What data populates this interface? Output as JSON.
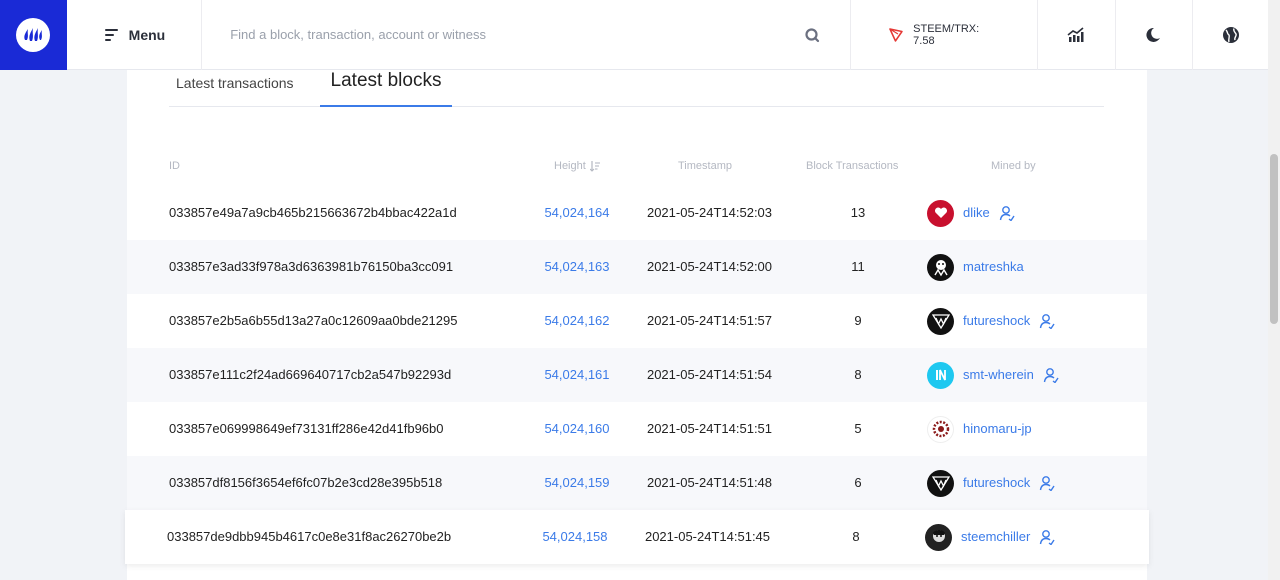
{
  "header": {
    "menu_label": "Menu",
    "search_placeholder": "Find a block, transaction, account or witness",
    "price_label": "STEEM/TRX: 7.58",
    "colors": {
      "brand": "#1a2ad6",
      "accent": "#3b7be8"
    }
  },
  "tabs": [
    {
      "label": "Latest transactions",
      "active": false
    },
    {
      "label": "Latest blocks",
      "active": true
    }
  ],
  "table": {
    "headers": {
      "id": "ID",
      "height": "Height",
      "timestamp": "Timestamp",
      "block_tx": "Block Transactions",
      "mined_by": "Mined by"
    },
    "rows": [
      {
        "id": "033857e49a7a9cb465b215663672b4bbac422a1d",
        "height": "54,024,164",
        "timestamp": "2021-05-24T14:52:03",
        "tx": "13",
        "miner": "dlike",
        "witness_icon": true
      },
      {
        "id": "033857e3ad33f978a3d6363981b76150ba3cc091",
        "height": "54,024,163",
        "timestamp": "2021-05-24T14:52:00",
        "tx": "11",
        "miner": "matreshka",
        "witness_icon": false
      },
      {
        "id": "033857e2b5a6b55d13a27a0c12609aa0bde21295",
        "height": "54,024,162",
        "timestamp": "2021-05-24T14:51:57",
        "tx": "9",
        "miner": "futureshock",
        "witness_icon": true
      },
      {
        "id": "033857e111c2f24ad669640717cb2a547b92293d",
        "height": "54,024,161",
        "timestamp": "2021-05-24T14:51:54",
        "tx": "8",
        "miner": "smt-wherein",
        "witness_icon": true
      },
      {
        "id": "033857e069998649ef73131ff286e42d41fb96b0",
        "height": "54,024,160",
        "timestamp": "2021-05-24T14:51:51",
        "tx": "5",
        "miner": "hinomaru-jp",
        "witness_icon": false
      },
      {
        "id": "033857df8156f3654ef6fc07b2e3cd28e395b518",
        "height": "54,024,159",
        "timestamp": "2021-05-24T14:51:48",
        "tx": "6",
        "miner": "futureshock",
        "witness_icon": true
      },
      {
        "id": "033857de9dbb945b4617c0e8e31f8ac26270be2b",
        "height": "54,024,158",
        "timestamp": "2021-05-24T14:51:45",
        "tx": "8",
        "miner": "steemchiller",
        "witness_icon": true
      }
    ]
  }
}
